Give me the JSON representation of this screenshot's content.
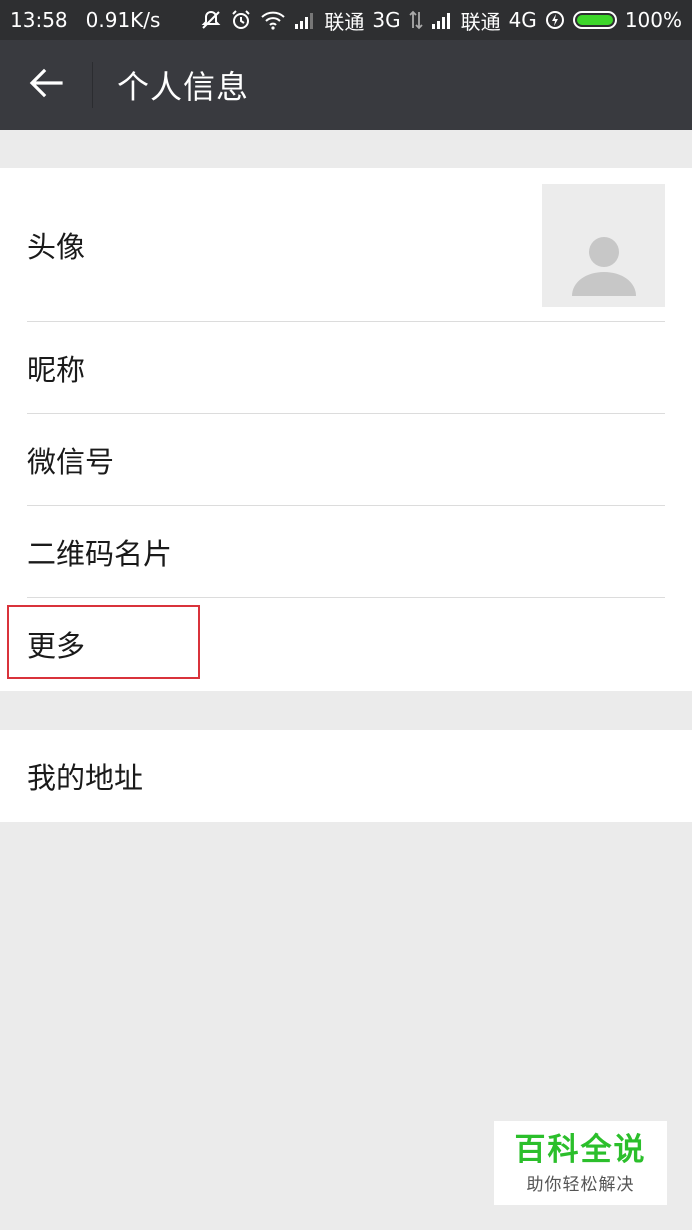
{
  "status_bar": {
    "time": "13:58",
    "net_speed": "0.91K/s",
    "carrier1": "联通",
    "net1": "3G",
    "carrier2": "联通",
    "net2": "4G",
    "battery": "100%"
  },
  "header": {
    "title": "个人信息",
    "back_icon": "arrow-left-icon"
  },
  "profile_items": [
    {
      "label": "头像"
    },
    {
      "label": "昵称"
    },
    {
      "label": "微信号"
    },
    {
      "label": "二维码名片"
    },
    {
      "label": "更多"
    }
  ],
  "address_item": {
    "label": "我的地址"
  },
  "watermark": {
    "title": "百科全说",
    "subtitle": "助你轻松解决"
  },
  "colors": {
    "status_bar_bg": "#2e2f31",
    "header_bg": "#393a3f",
    "page_bg": "#ebebeb",
    "highlight": "#d9333b",
    "watermark_green": "#2bbf2b",
    "battery_green": "#3dd62a"
  }
}
